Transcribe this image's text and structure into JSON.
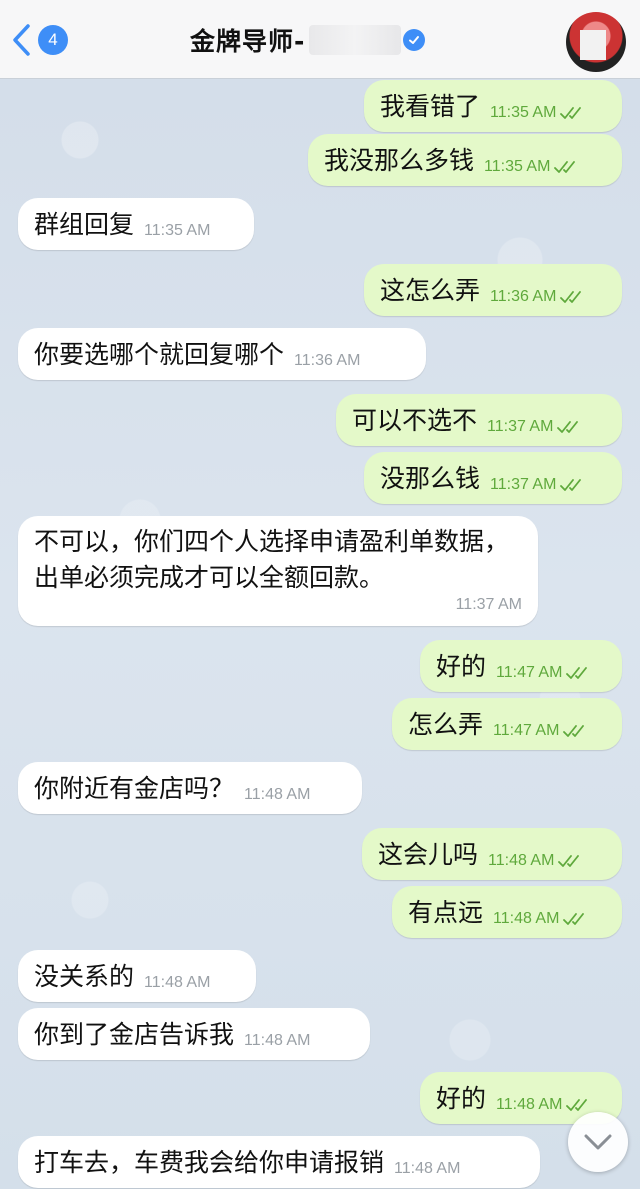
{
  "header": {
    "title": "金牌导师-",
    "unread_count": "4"
  },
  "messages": [
    {
      "dir": "out",
      "text": "我看错了",
      "time": "11:35 AM"
    },
    {
      "dir": "out",
      "text": "我没那么多钱",
      "time": "11:35 AM"
    },
    {
      "dir": "in",
      "text": "群组回复",
      "time": "11:35 AM"
    },
    {
      "dir": "out",
      "text": "这怎么弄",
      "time": "11:36 AM"
    },
    {
      "dir": "in",
      "text": "你要选哪个就回复哪个",
      "time": "11:36 AM"
    },
    {
      "dir": "out",
      "text": "可以不选不",
      "time": "11:37 AM"
    },
    {
      "dir": "out",
      "text": "没那么钱",
      "time": "11:37 AM"
    },
    {
      "dir": "in",
      "text": "不可以，你们四个人选择申请盈利单数据，出单必须完成才可以全额回款。",
      "time": "11:37 AM"
    },
    {
      "dir": "out",
      "text": "好的",
      "time": "11:47 AM"
    },
    {
      "dir": "out",
      "text": "怎么弄",
      "time": "11:47 AM"
    },
    {
      "dir": "in",
      "text": "你附近有金店吗？",
      "time": "11:48 AM"
    },
    {
      "dir": "out",
      "text": "这会儿吗",
      "time": "11:48 AM"
    },
    {
      "dir": "out",
      "text": "有点远",
      "time": "11:48 AM"
    },
    {
      "dir": "in",
      "text": "没关系的",
      "time": "11:48 AM"
    },
    {
      "dir": "in",
      "text": "你到了金店告诉我",
      "time": "11:48 AM"
    },
    {
      "dir": "out",
      "text": "好的",
      "time": "11:48 AM"
    },
    {
      "dir": "in",
      "text": "打车去，车费我会给你申请报销",
      "time": "11:48 AM"
    }
  ],
  "colors": {
    "outgoing_bubble": "#e4f9c9",
    "incoming_bubble": "#ffffff",
    "accent": "#3e8ef7",
    "read_check": "#5fa93c"
  },
  "icons": {
    "back": "chevron-left-icon",
    "verified": "verified-badge-icon",
    "read_status": "double-check-icon",
    "scroll_down": "chevron-down-icon"
  }
}
